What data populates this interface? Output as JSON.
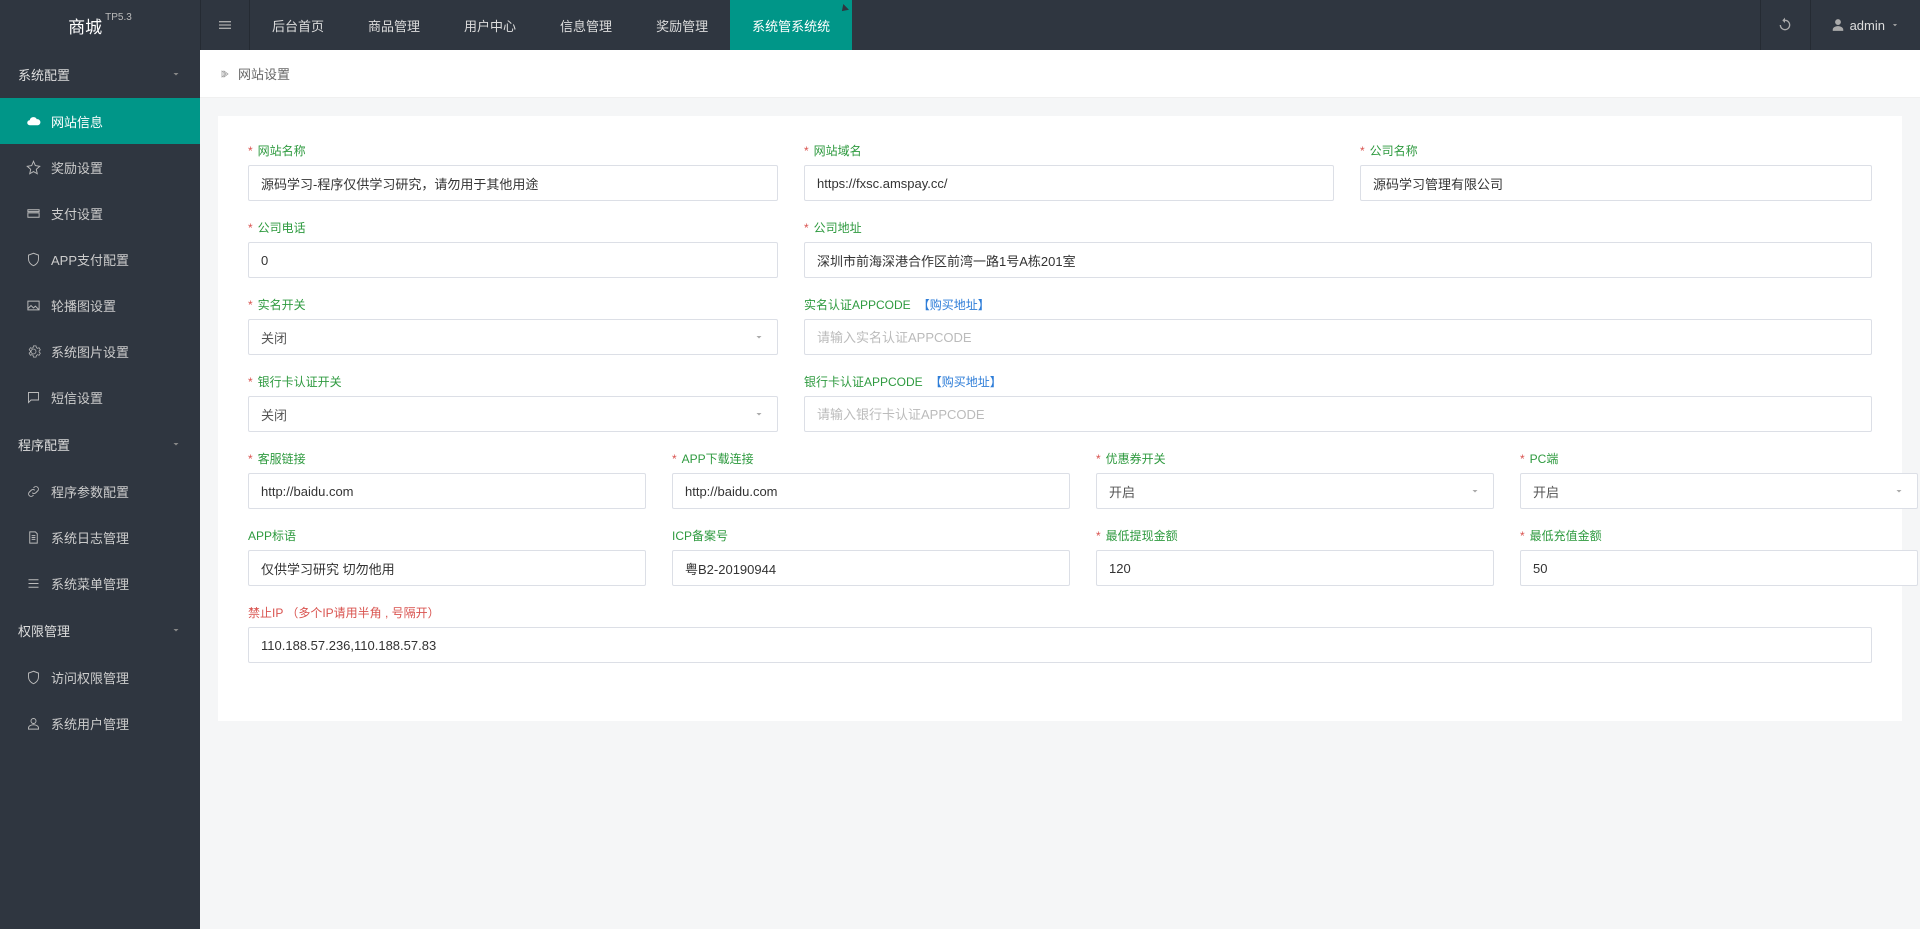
{
  "brand": {
    "name": "商城",
    "ver": "TP5.3"
  },
  "topnav": [
    {
      "label": "后台首页"
    },
    {
      "label": "商品管理"
    },
    {
      "label": "用户中心"
    },
    {
      "label": "信息管理"
    },
    {
      "label": "奖励管理"
    },
    {
      "label": "系统管系统统",
      "active": true
    }
  ],
  "user": {
    "name": "admin"
  },
  "sidebar": {
    "groups": [
      {
        "label": "系统配置",
        "kind": "cat"
      },
      {
        "label": "网站信息",
        "icon": "cloud",
        "active": true
      },
      {
        "label": "奖励设置",
        "icon": "star"
      },
      {
        "label": "支付设置",
        "icon": "card"
      },
      {
        "label": "APP支付配置",
        "icon": "shield"
      },
      {
        "label": "轮播图设置",
        "icon": "image"
      },
      {
        "label": "系统图片设置",
        "icon": "gear"
      },
      {
        "label": "短信设置",
        "icon": "msg"
      },
      {
        "label": "程序配置",
        "kind": "cat"
      },
      {
        "label": "程序参数配置",
        "icon": "link"
      },
      {
        "label": "系统日志管理",
        "icon": "doc"
      },
      {
        "label": "系统菜单管理",
        "icon": "menu"
      },
      {
        "label": "权限管理",
        "kind": "cat"
      },
      {
        "label": "访问权限管理",
        "icon": "shield"
      },
      {
        "label": "系统用户管理",
        "icon": "person"
      }
    ]
  },
  "crumb": {
    "page": "网站设置"
  },
  "form": {
    "site_name": {
      "label": "网站名称",
      "value": "源码学习-程序仅供学习研究，请勿用于其他用途"
    },
    "site_domain": {
      "label": "网站域名",
      "value": "https://fxsc.amspay.cc/"
    },
    "company_name": {
      "label": "公司名称",
      "value": "源码学习管理有限公司"
    },
    "company_phone": {
      "label": "公司电话",
      "value": "0"
    },
    "company_addr": {
      "label": "公司地址",
      "value": "深圳市前海深港合作区前湾一路1号A栋201室"
    },
    "realname_switch": {
      "label": "实名开关",
      "value": "关闭"
    },
    "realname_appcode": {
      "label": "实名认证APPCODE",
      "link": "【购买地址】",
      "placeholder": "请输入实名认证APPCODE",
      "value": ""
    },
    "bankcard_switch": {
      "label": "银行卡认证开关",
      "value": "关闭"
    },
    "bankcard_appcode": {
      "label": "银行卡认证APPCODE",
      "link": "【购买地址】",
      "placeholder": "请输入银行卡认证APPCODE",
      "value": ""
    },
    "kf_link": {
      "label": "客服链接",
      "value": "http://baidu.com"
    },
    "app_download": {
      "label": "APP下载连接",
      "value": "http://baidu.com"
    },
    "coupon_switch": {
      "label": "优惠券开关",
      "value": "开启"
    },
    "pc_switch": {
      "label": "PC端",
      "value": "开启"
    },
    "app_slogan": {
      "label": "APP标语",
      "value": "仅供学习研究 切勿他用"
    },
    "icp": {
      "label": "ICP备案号",
      "value": "粤B2-20190944"
    },
    "min_withdraw": {
      "label": "最低提现金额",
      "value": "120"
    },
    "min_recharge": {
      "label": "最低充值金额",
      "value": "50"
    },
    "ban_ip": {
      "label": "禁止IP",
      "hint": "（多个IP请用半角 , 号隔开）",
      "value": "110.188.57.236,110.188.57.83"
    }
  }
}
